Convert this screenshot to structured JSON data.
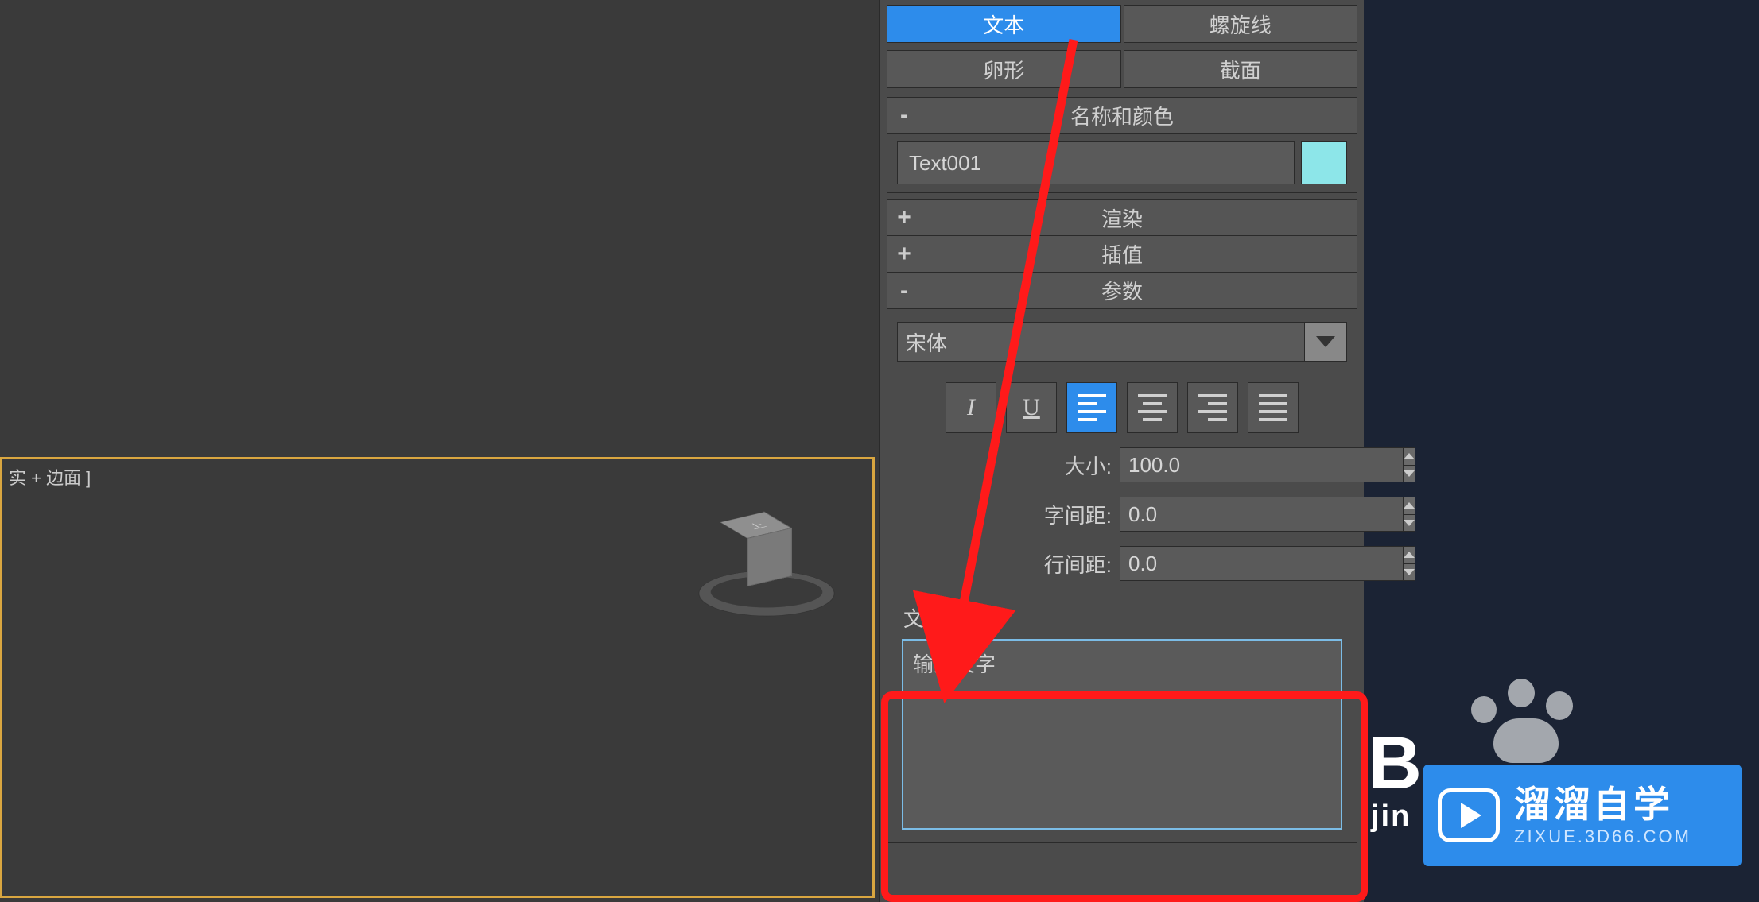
{
  "viewport": {
    "label": "实 + 边面 ]"
  },
  "object_types": {
    "text": "文本",
    "helix": "螺旋线",
    "egg": "卵形",
    "section": "截面"
  },
  "rollouts": {
    "name_color": {
      "title": "名称和颜色",
      "toggle": "-"
    },
    "render": {
      "title": "渲染",
      "toggle": "+"
    },
    "interp": {
      "title": "插值",
      "toggle": "+"
    },
    "params": {
      "title": "参数",
      "toggle": "-"
    }
  },
  "object_name": "Text001",
  "color_swatch": "#8de6e9",
  "font": "宋体",
  "params": {
    "size": {
      "label": "大小:",
      "value": "100.0"
    },
    "kerning": {
      "label": "字间距:",
      "value": "0.0"
    },
    "leading": {
      "label": "行间距:",
      "value": "0.0"
    }
  },
  "text_field": {
    "label": "文本:",
    "value": "输入文字"
  },
  "watermark": {
    "big": "B",
    "small": "jin",
    "brand_cn": "溜溜自学",
    "brand_url": "ZIXUE.3D66.COM"
  }
}
